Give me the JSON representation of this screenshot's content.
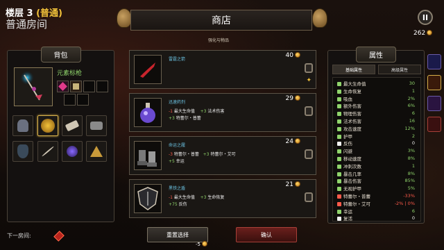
{
  "hud": {
    "floor_label": "楼层 3",
    "floor_mode": "(普通)",
    "room_type": "普通房间",
    "pause_label": "II",
    "gold": "262"
  },
  "shop": {
    "title": "商店",
    "subtitle": "强化与物品",
    "cards": [
      {
        "name": "雷霆之箭",
        "price": "40",
        "icon": "red-arrow-icon",
        "lines": []
      },
      {
        "name": "迅速药剂",
        "price": "29",
        "icon": "potion-icon",
        "l1": {
          "a": "-1",
          "a_stat": "最大生命值",
          "b": "+3",
          "b_stat": "法术伤害"
        },
        "l2": {
          "a": "+3",
          "a_stat": "特蕾尔・普蕾"
        }
      },
      {
        "name": "命运之履",
        "price": "24",
        "icon": "boots-icon",
        "l1": {
          "a": "-3",
          "a_stat": "特蕾尔・普蕾",
          "b": "+3",
          "b_stat": "特蕾尔・艾可"
        },
        "l2": {
          "a": "+5",
          "a_stat": "幸运"
        }
      },
      {
        "name": "黑铁之盾",
        "price": "21",
        "icon": "shield-icon",
        "l1": {
          "a": "-1",
          "a_stat": "最大生命值",
          "b": "+3",
          "b_stat": "生命恢复"
        },
        "l2": {
          "a": "+75",
          "a_stat": "反伤"
        }
      }
    ],
    "reroll_label": "重置选择",
    "reroll_cost": "-5",
    "confirm_label": "确认"
  },
  "backpack": {
    "title": "背包",
    "weapon_name": "元素标枪",
    "next_room_label": "下一房间:"
  },
  "attributes": {
    "title": "属性",
    "tab_basic": "基础属性",
    "tab_advanced": "高级属性",
    "rows": [
      {
        "name": "最大生命值",
        "value": "30",
        "color": "#8fd36b"
      },
      {
        "name": "生命恢复",
        "value": "1",
        "color": "#8fd36b"
      },
      {
        "name": "吸血",
        "value": "2%",
        "color": "#8fd36b"
      },
      {
        "name": "额外伤害",
        "value": "6%",
        "color": "#8fd36b"
      },
      {
        "name": "物理伤害",
        "value": "6",
        "color": "#8fd36b"
      },
      {
        "name": "法术伤害",
        "value": "16",
        "color": "#8fd36b"
      },
      {
        "name": "攻击速度",
        "value": "12%",
        "color": "#8fd36b"
      },
      {
        "name": "护甲",
        "value": "2",
        "color": "#8fd36b"
      },
      {
        "name": "反伤",
        "value": "0",
        "color": "#f0f0f0"
      },
      {
        "name": "闪避",
        "value": "3%",
        "color": "#8fd36b"
      },
      {
        "name": "移动速度",
        "value": "8%",
        "color": "#8fd36b"
      },
      {
        "name": "冲刺次数",
        "value": "1",
        "color": "#8fd36b"
      },
      {
        "name": "暴击几率",
        "value": "8%",
        "color": "#8fd36b"
      },
      {
        "name": "暴击伤害",
        "value": "85%",
        "color": "#8fd36b"
      },
      {
        "name": "无视护甲",
        "value": "5%",
        "color": "#8fd36b"
      },
      {
        "name": "特蕾尔・普蕾",
        "value": "-33%",
        "color": "#ff5a4a"
      },
      {
        "name": "特蕾尔・艾可",
        "value": "-2% | 0%",
        "color": "#ff5a4a"
      },
      {
        "name": "幸运",
        "value": "6",
        "color": "#8fd36b"
      },
      {
        "name": "复活",
        "value": "0",
        "color": "#f0f0f0"
      }
    ]
  },
  "colors": {
    "accent": "#f2c23a",
    "positive": "#8fd36b",
    "negative": "#ff5a4a"
  }
}
